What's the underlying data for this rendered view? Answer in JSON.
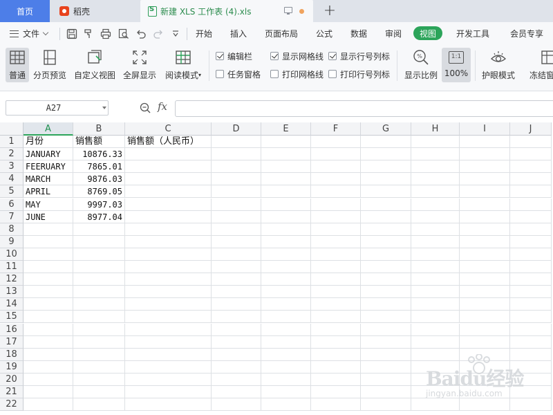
{
  "tabs": {
    "home": "首页",
    "daoke": "稻壳",
    "file": "新建 XLS 工作表 (4).xls",
    "new_tab_symbol": "+"
  },
  "menu": {
    "file": "文件",
    "items": [
      "开始",
      "插入",
      "页面布局",
      "公式",
      "数据",
      "审阅",
      "视图",
      "开发工具",
      "会员专享"
    ],
    "active": "视图"
  },
  "ribbon": {
    "buttons": {
      "normal": "普通",
      "page_break": "分页预览",
      "custom_view": "自定义视图",
      "full_screen": "全屏显示",
      "reading_mode": "阅读模式",
      "zoom_ratio": "显示比例",
      "zoom_100": "100%",
      "eye_protect": "护眼模式",
      "freeze": "冻结窗"
    },
    "checkboxes": {
      "edit_bar": {
        "label": "编辑栏",
        "checked": true
      },
      "task_pane": {
        "label": "任务窗格",
        "checked": false
      },
      "show_gridlines": {
        "label": "显示网格线",
        "checked": true
      },
      "print_gridlines": {
        "label": "打印网格线",
        "checked": false
      },
      "show_headers": {
        "label": "显示行号列标",
        "checked": true
      },
      "print_headers": {
        "label": "打印行号列标",
        "checked": false
      }
    },
    "zoom_100_icon_text": "1:1"
  },
  "formula_bar": {
    "name_box": "A27",
    "fx": "fx",
    "formula": ""
  },
  "sheet": {
    "columns": [
      "A",
      "B",
      "C",
      "D",
      "E",
      "F",
      "G",
      "H",
      "I",
      "J"
    ],
    "selected_column": "A",
    "rows": [
      "1",
      "2",
      "3",
      "4",
      "5",
      "6",
      "7",
      "8",
      "9",
      "10",
      "11",
      "12",
      "13",
      "14",
      "15",
      "16",
      "17",
      "18",
      "19",
      "20",
      "21",
      "22"
    ],
    "cells": {
      "A1": "月份",
      "B1": "销售额",
      "C1": "销售额（人民币）",
      "A2": "JANUARY",
      "B2": "10876.33",
      "A3": "FEERUARY",
      "B3": "7865.01",
      "A4": "MARCH",
      "B4": "9876.03",
      "A5": "APRIL",
      "B5": "8769.05",
      "A6": "MAY",
      "B6": "9997.03",
      "A7": "JUNE",
      "B7": "8977.04"
    }
  },
  "watermark": {
    "brand": "Baidu经验",
    "url": "jingyan.baidu.com"
  }
}
